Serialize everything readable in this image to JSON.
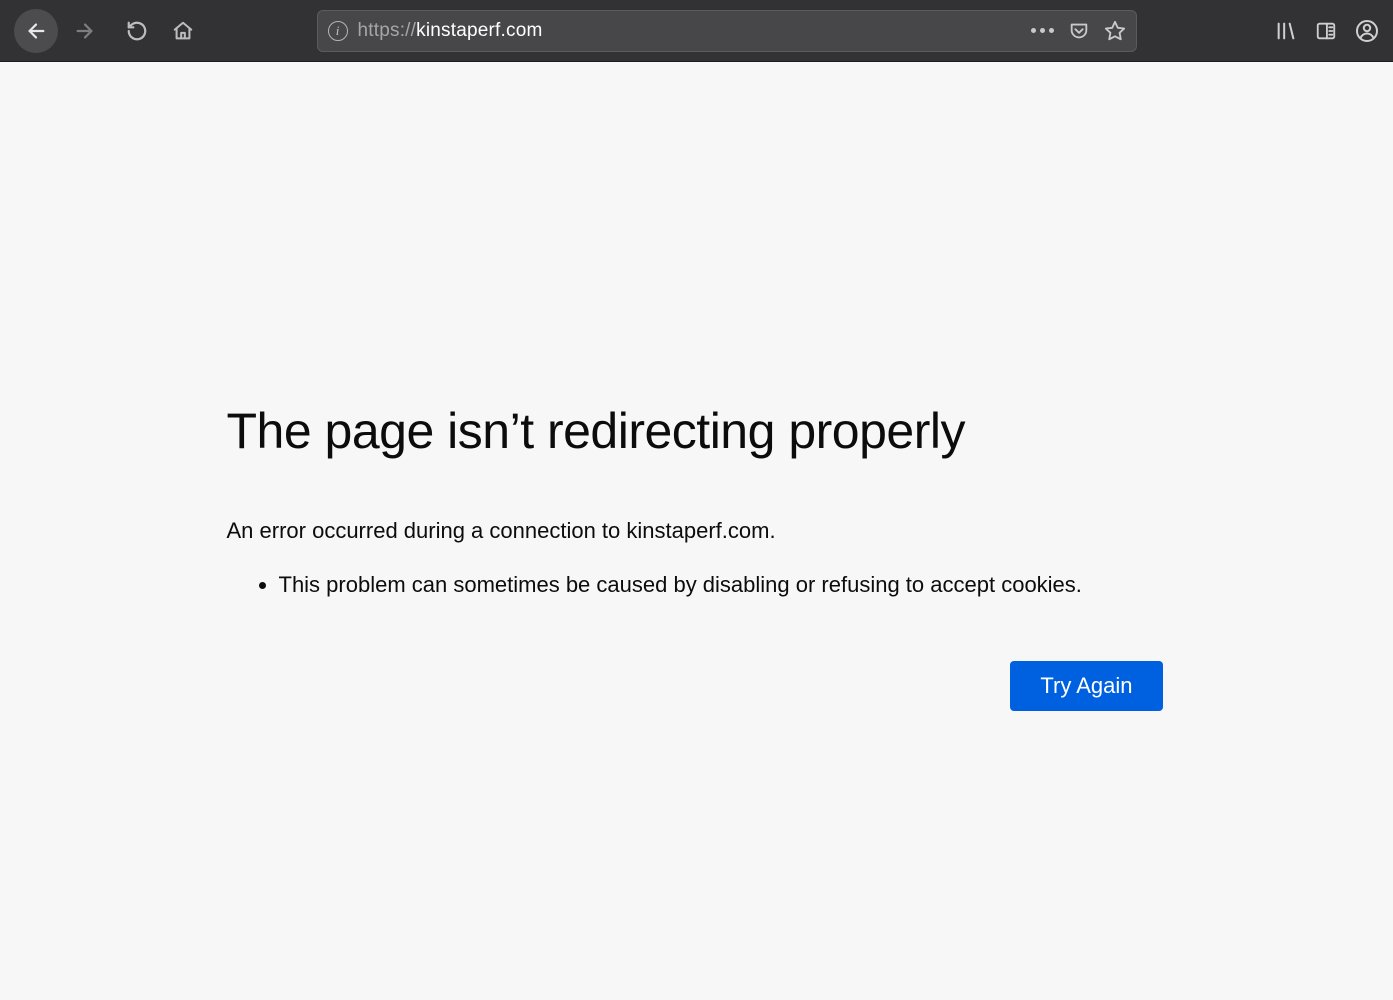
{
  "browser": {
    "url_scheme": "https://",
    "url_host": "kinstaperf.com",
    "url_path": ""
  },
  "error": {
    "title": "The page isn’t redirecting properly",
    "description": "An error occurred during a connection to kinstaperf.com.",
    "bullets": [
      "This problem can sometimes be caused by disabling or refusing to accept cookies."
    ],
    "try_again_label": "Try Again"
  }
}
